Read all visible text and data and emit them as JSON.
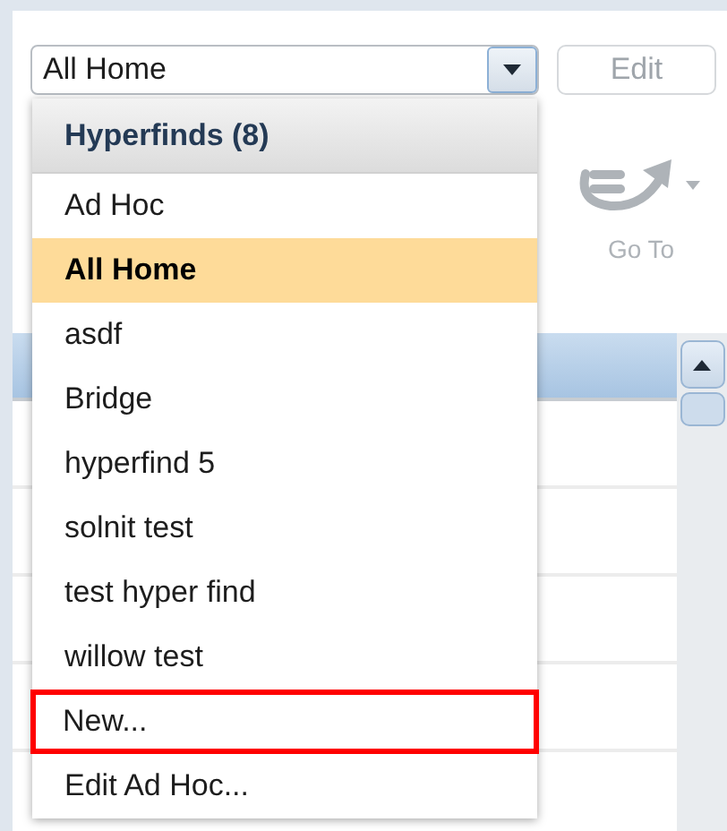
{
  "combo": {
    "value": "All Home"
  },
  "edit_button": {
    "label": "Edit",
    "disabled": true
  },
  "goto": {
    "label": "Go To",
    "disabled": true
  },
  "dropdown": {
    "header": "Hyperfinds (8)",
    "items": [
      {
        "label": "Ad Hoc",
        "selected": false,
        "outlined": false
      },
      {
        "label": "All Home",
        "selected": true,
        "outlined": false
      },
      {
        "label": "asdf",
        "selected": false,
        "outlined": false
      },
      {
        "label": "Bridge",
        "selected": false,
        "outlined": false
      },
      {
        "label": "hyperfind 5",
        "selected": false,
        "outlined": false
      },
      {
        "label": "solnit test",
        "selected": false,
        "outlined": false
      },
      {
        "label": "test hyper find",
        "selected": false,
        "outlined": false
      },
      {
        "label": "willow test",
        "selected": false,
        "outlined": false
      },
      {
        "label": "New...",
        "selected": false,
        "outlined": true
      },
      {
        "label": "Edit Ad Hoc...",
        "selected": false,
        "outlined": false
      }
    ]
  }
}
